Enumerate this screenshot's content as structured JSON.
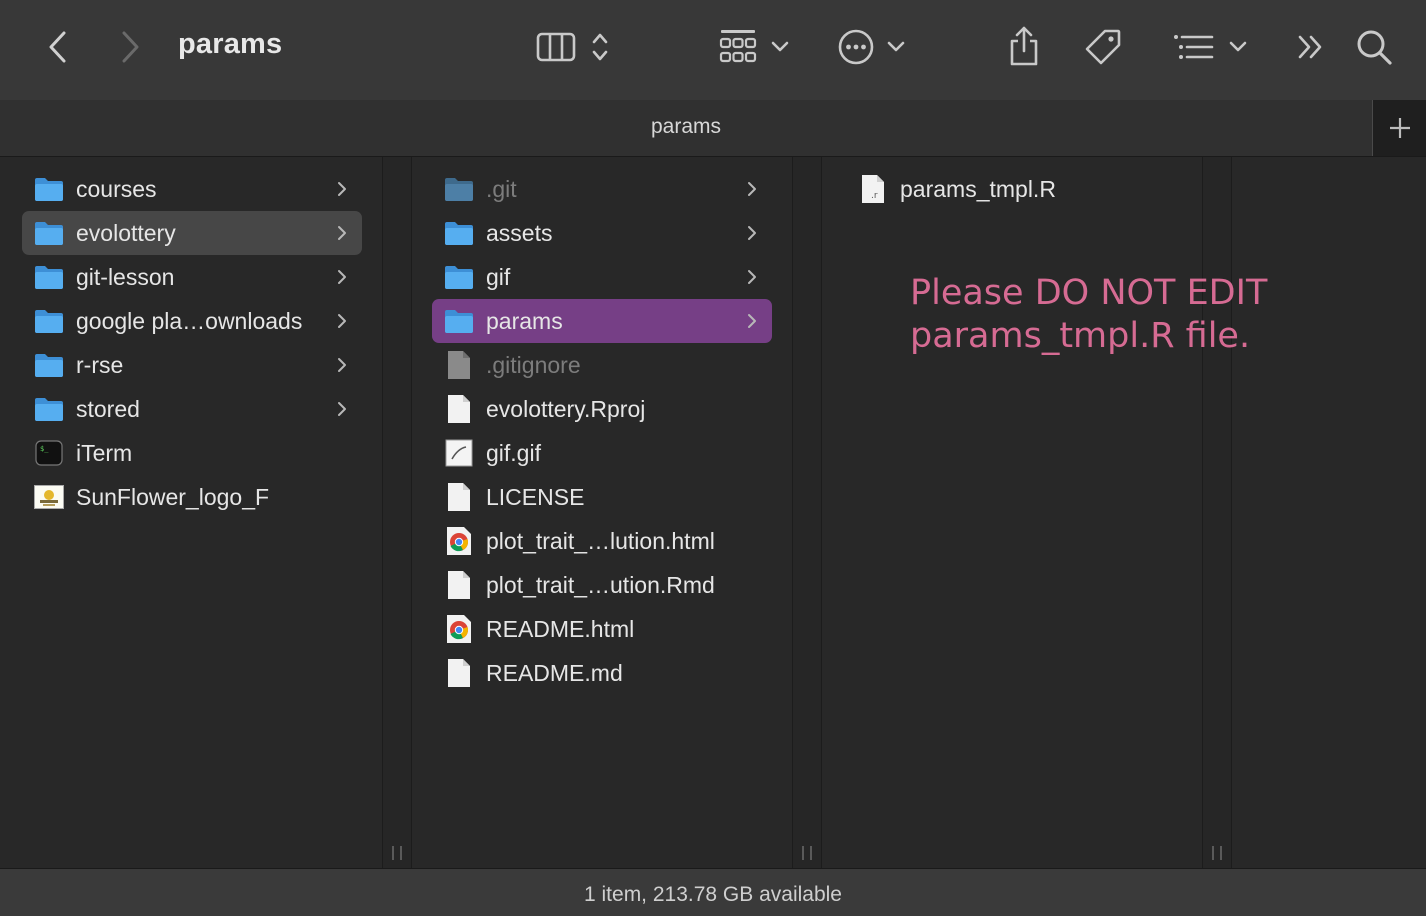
{
  "window": {
    "title": "params",
    "tab_title": "params",
    "status": "1 item, 213.78 GB available"
  },
  "toolbar": {
    "icons": [
      "back-chevron-icon",
      "forward-chevron-icon",
      "column-view-icon",
      "view-options-stepper-icon",
      "group-grid-icon",
      "chevron-down-icon",
      "more-actions-icon",
      "share-icon",
      "tag-icon",
      "list-sort-icon",
      "overflow-chevrons-icon",
      "search-icon"
    ]
  },
  "column1": {
    "items": [
      {
        "label": "courses",
        "icon": "folder",
        "chevron": true
      },
      {
        "label": "evolottery",
        "icon": "folder",
        "chevron": true,
        "selected": true
      },
      {
        "label": "git-lesson",
        "icon": "folder",
        "chevron": true
      },
      {
        "label": "google pla…ownloads",
        "icon": "folder",
        "chevron": true
      },
      {
        "label": "r-rse",
        "icon": "folder",
        "chevron": true
      },
      {
        "label": "stored",
        "icon": "folder",
        "chevron": true
      },
      {
        "label": "iTerm",
        "icon": "terminal-app",
        "chevron": false
      },
      {
        "label": "SunFlower_logo_F",
        "icon": "image-thumbnail",
        "chevron": false
      }
    ]
  },
  "column2": {
    "items": [
      {
        "label": ".git",
        "icon": "folder-dim",
        "chevron": true,
        "dim": true
      },
      {
        "label": "assets",
        "icon": "folder",
        "chevron": true
      },
      {
        "label": "gif",
        "icon": "folder",
        "chevron": true
      },
      {
        "label": "params",
        "icon": "folder",
        "chevron": true,
        "selected": true
      },
      {
        "label": ".gitignore",
        "icon": "file-dim",
        "chevron": false,
        "dim": true
      },
      {
        "label": "evolottery.Rproj",
        "icon": "file",
        "chevron": false
      },
      {
        "label": "gif.gif",
        "icon": "gif-file",
        "chevron": false
      },
      {
        "label": "LICENSE",
        "icon": "file",
        "chevron": false
      },
      {
        "label": "plot_trait_…lution.html",
        "icon": "chrome-html",
        "chevron": false
      },
      {
        "label": "plot_trait_…ution.Rmd",
        "icon": "file",
        "chevron": false
      },
      {
        "label": "README.html",
        "icon": "chrome-html",
        "chevron": false
      },
      {
        "label": "README.md",
        "icon": "file",
        "chevron": false
      }
    ]
  },
  "column3": {
    "items": [
      {
        "label": "params_tmpl.R",
        "icon": "r-file",
        "chevron": false
      }
    ]
  },
  "annotation": {
    "line1": "Please DO NOT EDIT",
    "line2": "params_tmpl.R file.",
    "color": "#d66b93"
  },
  "colors": {
    "selection_purple": "#763f86",
    "selection_gray": "#474747",
    "folder_blue": "#4aa3e6"
  }
}
